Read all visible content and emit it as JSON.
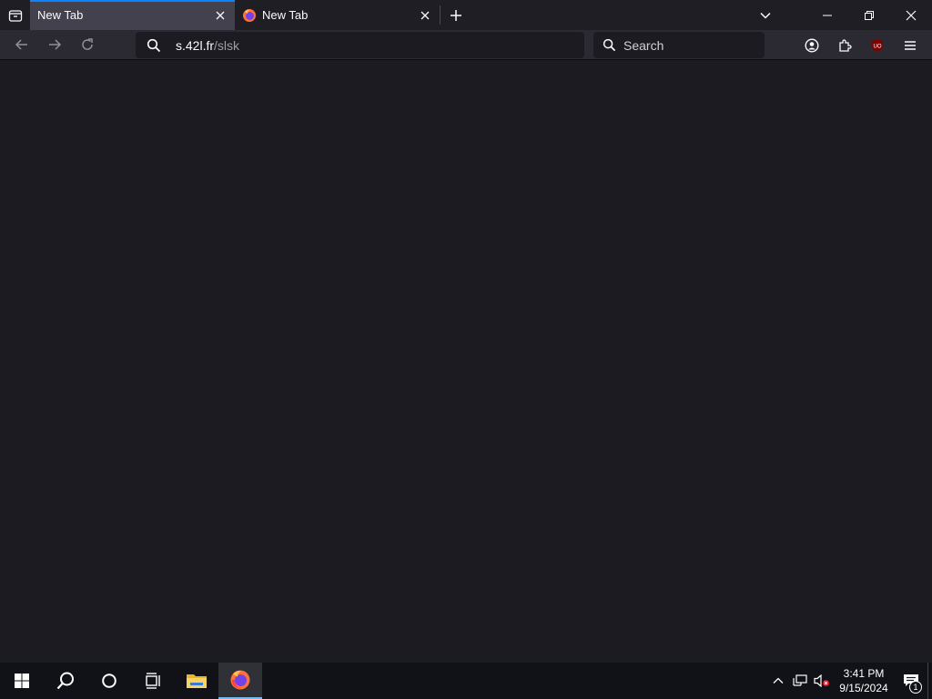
{
  "browser": {
    "tabs": [
      {
        "label": "New Tab",
        "active": true
      },
      {
        "label": "New Tab",
        "active": false
      }
    ],
    "url": {
      "host": "s.42l.fr",
      "path": "/slsk"
    },
    "search": {
      "placeholder": "Search"
    },
    "extension_badge": "UO",
    "colors": {
      "accent": "#0b84ff",
      "content_bg": "#1c1b22",
      "toolbar_bg": "#2b2a33"
    }
  },
  "taskbar": {
    "time": "3:41 PM",
    "date": "9/15/2024",
    "notification_count": "1"
  }
}
